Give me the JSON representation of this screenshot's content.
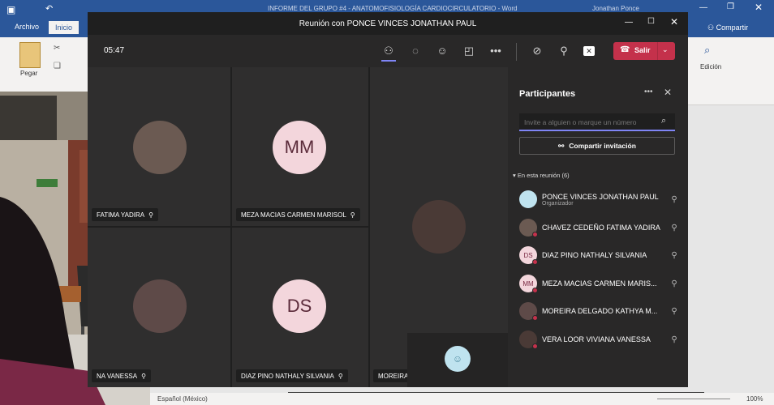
{
  "word": {
    "title": "INFORME DEL GRUPO #4 - ANATOMOFISIOLOGÍA CARDIOCIRCULATORIO - Word",
    "user": "Jonathan Ponce",
    "tabs": [
      "Archivo",
      "Inicio"
    ],
    "share_label": "Compartir",
    "paste_label": "Pegar",
    "edit_label": "Edición",
    "status_language": "Español (México)",
    "zoom": "100%"
  },
  "teams": {
    "meeting_title": "Reunión con PONCE VINCES JONATHAN PAUL",
    "timer": "05:47",
    "leave_label": "Salir",
    "tiles": [
      {
        "name": "FATIMA YADIRA",
        "initials": ""
      },
      {
        "name": "MEZA MACIAS CARMEN MARISOL",
        "initials": "MM"
      },
      {
        "name": "",
        "initials": ""
      },
      {
        "name": "NA VANESSA",
        "initials": ""
      },
      {
        "name": "DIAZ PINO NATHALY SILVANIA",
        "initials": "DS"
      },
      {
        "name": "MOREIRA",
        "initials": ""
      }
    ],
    "panel": {
      "title": "Participantes",
      "search_placeholder": "Invite a alguien o marque un número",
      "share_invite": "Compartir invitación",
      "section": "En esta reunión (6)",
      "participants": [
        {
          "name": "PONCE VINCES JONATHAN PAUL",
          "role": "Organizador",
          "initials": ""
        },
        {
          "name": "CHAVEZ CEDEÑO FATIMA YADIRA",
          "role": "",
          "initials": ""
        },
        {
          "name": "DIAZ PINO NATHALY SILVANIA",
          "role": "",
          "initials": "DS"
        },
        {
          "name": "MEZA MACIAS CARMEN MARIS...",
          "role": "",
          "initials": "MM"
        },
        {
          "name": "MOREIRA DELGADO KATHYA M...",
          "role": "",
          "initials": ""
        },
        {
          "name": "VERA LOOR VIVIANA VANESSA",
          "role": "",
          "initials": ""
        }
      ]
    }
  }
}
